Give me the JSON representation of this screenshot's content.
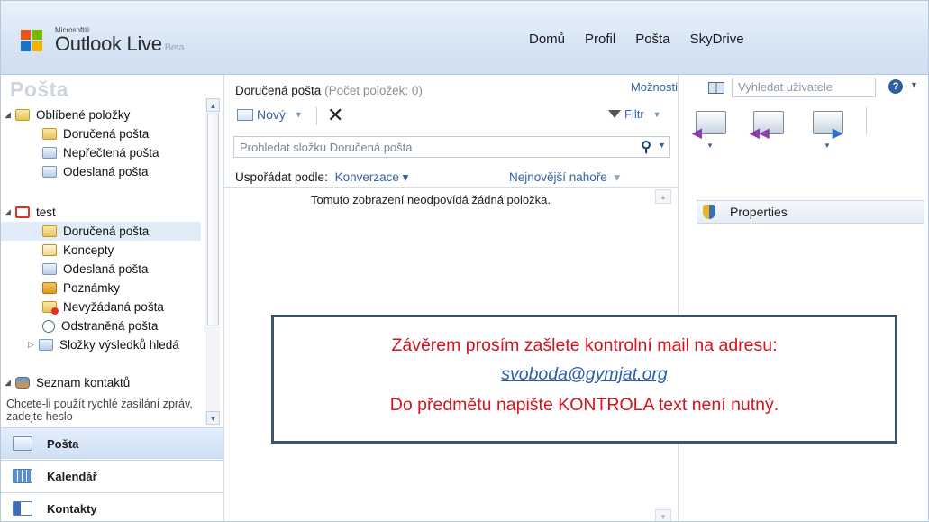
{
  "header": {
    "logo_small": "Microsoft®",
    "logo_main": "Outlook Live",
    "logo_beta": "Beta",
    "nav": [
      "Domů",
      "Profil",
      "Pošta",
      "SkyDrive"
    ]
  },
  "section_title": "Pošta",
  "folders": {
    "favorites_label": "Oblíbené položky",
    "favorites": [
      "Doručená pošta",
      "Nepřečtená pošta",
      "Odeslaná pošta"
    ],
    "account_label": "test",
    "account_folders": [
      "Doručená pošta",
      "Koncepty",
      "Odeslaná pošta",
      "Poznámky",
      "Nevyžádaná pošta",
      "Odstraněná pošta",
      "Složky výsledků hledá"
    ],
    "selected": "Doručená pošta",
    "contacts_label": "Seznam kontaktů",
    "chat_hint": "Chcete-li použít rychlé zasílání zpráv, zadejte heslo"
  },
  "bottom_nav": {
    "items": [
      "Pošta",
      "Kalendář",
      "Kontakty"
    ],
    "active": "Pošta"
  },
  "inbox": {
    "title": "Doručená pošta",
    "count_label": "(Počet položek: 0)",
    "options_link": "Možnosti",
    "new_label": "Nový",
    "filter_label": "Filtr",
    "search_placeholder": "Prohledat složku Doručená pošta",
    "sort_label": "Uspořádat podle:",
    "sort_value": "Konverzace",
    "sort_order": "Nejnovější nahoře",
    "empty_message": "Tomuto zobrazení neodpovídá žádná položka."
  },
  "right": {
    "contact_search_placeholder": "Vyhledat uživatele",
    "help_icon": "?",
    "properties_label": "Properties",
    "actions": [
      "reply-icon",
      "reply-all-icon",
      "forward-icon"
    ]
  },
  "notice": {
    "line1": "Závěrem prosím zašlete kontrolní mail na adresu:",
    "email": "svoboda@gymjat.org",
    "line3": "Do předmětu napište KONTROLA text není nutný."
  },
  "colors": {
    "link": "#3465a4",
    "notice_text": "#d2141e",
    "header_bg": "#d6e5f5",
    "selected_row": "#e1ecf8"
  }
}
